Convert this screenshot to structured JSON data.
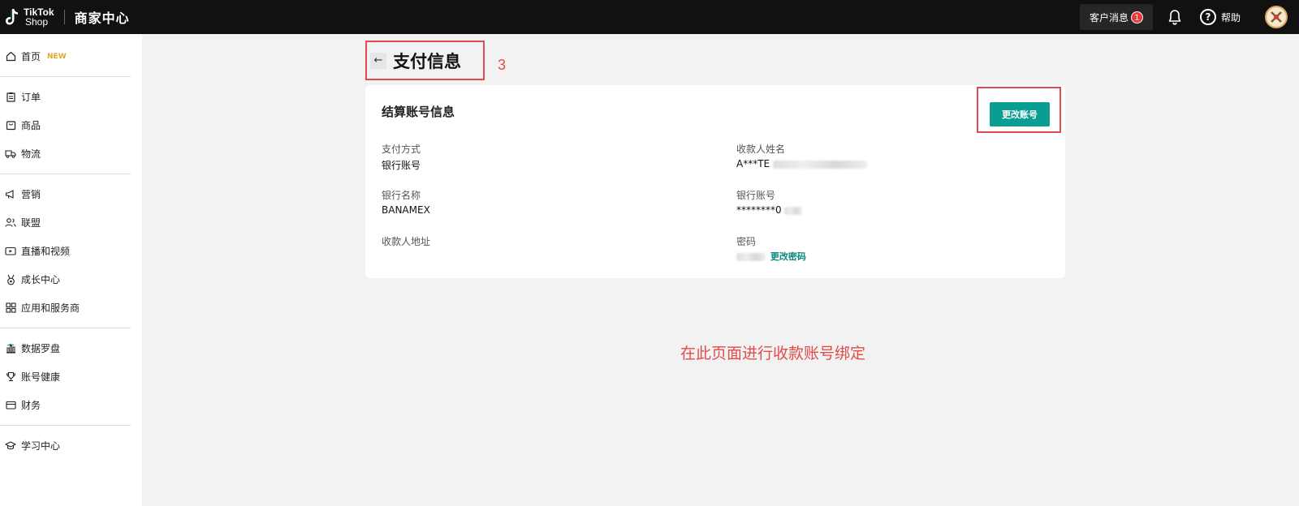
{
  "topbar": {
    "logo_line1": "TikTok",
    "logo_line2": "Shop",
    "title": "商家中心",
    "messages_label": "客户消息",
    "messages_count": "1",
    "help_label": "帮助"
  },
  "sidebar": {
    "home_label": "首页",
    "home_badge": "NEW",
    "orders": "订单",
    "products": "商品",
    "logistics": "物流",
    "marketing": "营销",
    "affiliate": "联盟",
    "live_video": "直播和视频",
    "growth": "成长中心",
    "apps": "应用和服务商",
    "data_compass": "数据罗盘",
    "account_health": "账号健康",
    "finance": "财务",
    "learning": "学习中心"
  },
  "page": {
    "title": "支付信息",
    "step_annotation": "3",
    "bottom_annotation": "在此页面进行收款账号绑定"
  },
  "card": {
    "title": "结算账号信息",
    "change_account_button": "更改账号",
    "payment_method_label": "支付方式",
    "payment_method_value": "银行账号",
    "payee_name_label": "收款人姓名",
    "payee_name_value": "A***TE",
    "bank_name_label": "银行名称",
    "bank_name_value": "BANAMEX",
    "bank_account_label": "银行账号",
    "bank_account_value": "********0",
    "payee_address_label": "收款人地址",
    "password_label": "密码",
    "change_password_link": "更改密码"
  },
  "colors": {
    "accent": "#0a9e93",
    "annotation": "#e24b4b",
    "topbar": "#111111"
  }
}
